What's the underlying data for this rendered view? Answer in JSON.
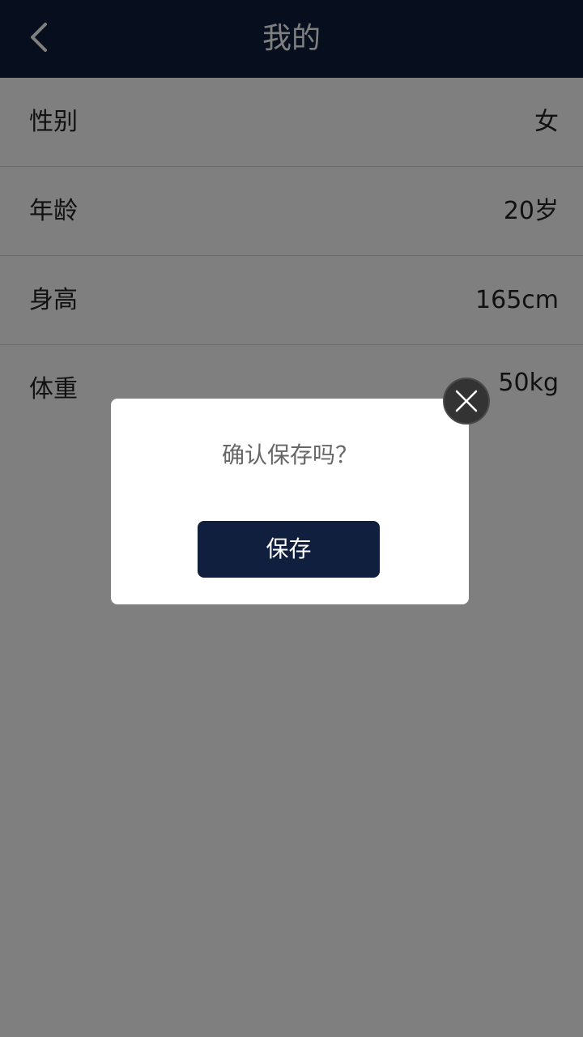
{
  "header": {
    "title": "我的",
    "back_icon": "chevron-left-icon"
  },
  "profile": {
    "rows": [
      {
        "label": "性别",
        "value": "女"
      },
      {
        "label": "年龄",
        "value": "20岁"
      },
      {
        "label": "身高",
        "value": "165cm"
      },
      {
        "label": "体重",
        "value": "50kg"
      }
    ]
  },
  "dialog": {
    "message": "确认保存吗？",
    "save_label": "保存",
    "close_icon": "close-icon"
  },
  "colors": {
    "header_bg": "#0f1f3d",
    "button_bg": "#0f1f3d"
  }
}
